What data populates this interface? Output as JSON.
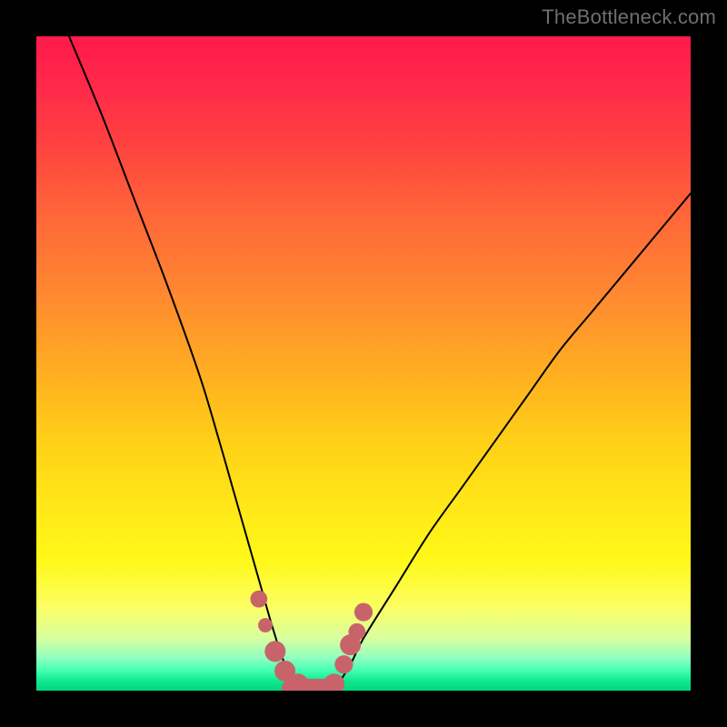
{
  "watermark": "TheBottleneck.com",
  "colors": {
    "frame": "#000000",
    "curve": "#000000",
    "marker": "#c9636a",
    "gradient_top": "#ff1a4a",
    "gradient_bottom": "#00d880"
  },
  "chart_data": {
    "type": "line",
    "title": "",
    "xlabel": "",
    "ylabel": "",
    "xlim": [
      0,
      100
    ],
    "ylim": [
      0,
      100
    ],
    "grid": false,
    "legend": false,
    "background": "rainbow-vertical-gradient",
    "description": "V-shaped bottleneck curve: steep descent from top-left, flat minimum near x≈38–45%, shallower rise to upper-right. Y-axis inverted visually (0 at bottom = good/green, 100 at top = bad/red).",
    "series": [
      {
        "name": "bottleneck_curve",
        "x": [
          5,
          10,
          15,
          20,
          25,
          28,
          30,
          32,
          34,
          36,
          38,
          40,
          42,
          44,
          46,
          48,
          50,
          55,
          60,
          65,
          70,
          75,
          80,
          85,
          90,
          95,
          100
        ],
        "y": [
          100,
          88,
          75,
          62,
          48,
          38,
          31,
          24,
          17,
          10,
          4,
          1,
          0,
          0,
          1,
          4,
          8,
          16,
          24,
          31,
          38,
          45,
          52,
          58,
          64,
          70,
          76
        ]
      }
    ],
    "markers": [
      {
        "x": 34,
        "y": 14,
        "r": 1.3
      },
      {
        "x": 35,
        "y": 10,
        "r": 1.1
      },
      {
        "x": 36.5,
        "y": 6,
        "r": 1.6
      },
      {
        "x": 38,
        "y": 3,
        "r": 1.6
      },
      {
        "x": 40,
        "y": 1,
        "r": 1.6
      },
      {
        "x": 42,
        "y": 0,
        "r": 1.6
      },
      {
        "x": 44,
        "y": 0,
        "r": 1.6
      },
      {
        "x": 45.5,
        "y": 1,
        "r": 1.6
      },
      {
        "x": 47,
        "y": 4,
        "r": 1.4
      },
      {
        "x": 48,
        "y": 7,
        "r": 1.6
      },
      {
        "x": 49,
        "y": 9,
        "r": 1.3
      },
      {
        "x": 50,
        "y": 12,
        "r": 1.4
      }
    ],
    "flat_segment": {
      "x0": 39,
      "x1": 45,
      "y": 0
    }
  }
}
